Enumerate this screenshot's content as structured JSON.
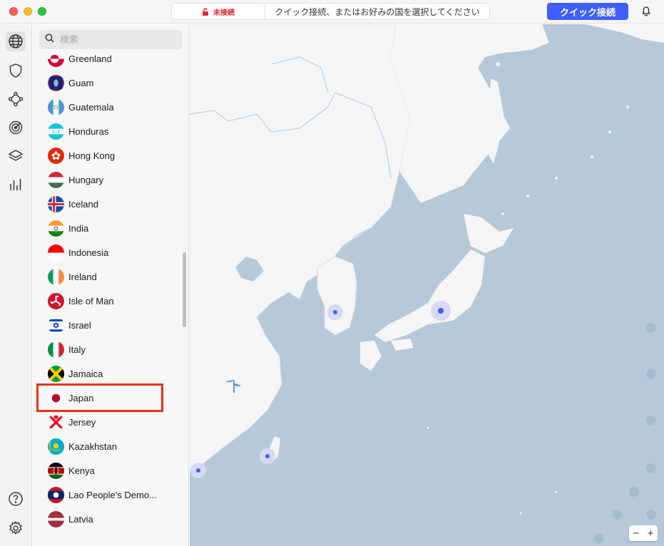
{
  "titlebar": {
    "status_label": "未接続",
    "status_message": "クイック接続、またはお好みの国を選択してください",
    "quick_connect_label": "クイック接続"
  },
  "search": {
    "placeholder": "検索"
  },
  "countries": [
    {
      "name": "Greenland",
      "flag": "greenland-flag-icon"
    },
    {
      "name": "Guam",
      "flag": "guam-flag-icon"
    },
    {
      "name": "Guatemala",
      "flag": "guatemala-flag-icon"
    },
    {
      "name": "Honduras",
      "flag": "honduras-flag-icon"
    },
    {
      "name": "Hong Kong",
      "flag": "hong-kong-flag-icon"
    },
    {
      "name": "Hungary",
      "flag": "hungary-flag-icon"
    },
    {
      "name": "Iceland",
      "flag": "iceland-flag-icon"
    },
    {
      "name": "India",
      "flag": "india-flag-icon"
    },
    {
      "name": "Indonesia",
      "flag": "indonesia-flag-icon"
    },
    {
      "name": "Ireland",
      "flag": "ireland-flag-icon"
    },
    {
      "name": "Isle of Man",
      "flag": "isle-of-man-flag-icon"
    },
    {
      "name": "Israel",
      "flag": "israel-flag-icon"
    },
    {
      "name": "Italy",
      "flag": "italy-flag-icon"
    },
    {
      "name": "Jamaica",
      "flag": "jamaica-flag-icon"
    },
    {
      "name": "Japan",
      "flag": "japan-flag-icon"
    },
    {
      "name": "Jersey",
      "flag": "jersey-flag-icon"
    },
    {
      "name": "Kazakhstan",
      "flag": "kazakhstan-flag-icon"
    },
    {
      "name": "Kenya",
      "flag": "kenya-flag-icon"
    },
    {
      "name": "Lao People's Demo...",
      "flag": "laos-flag-icon"
    },
    {
      "name": "Latvia",
      "flag": "latvia-flag-icon"
    }
  ],
  "highlighted_country": "Japan",
  "map": {
    "zoom_out_label": "−",
    "zoom_in_label": "+"
  },
  "colors": {
    "accent": "#3e5fff",
    "disconnected": "#e0242f",
    "highlight": "#ec3018",
    "sea": "#b6c9d9",
    "land": "#f5f5f5"
  }
}
